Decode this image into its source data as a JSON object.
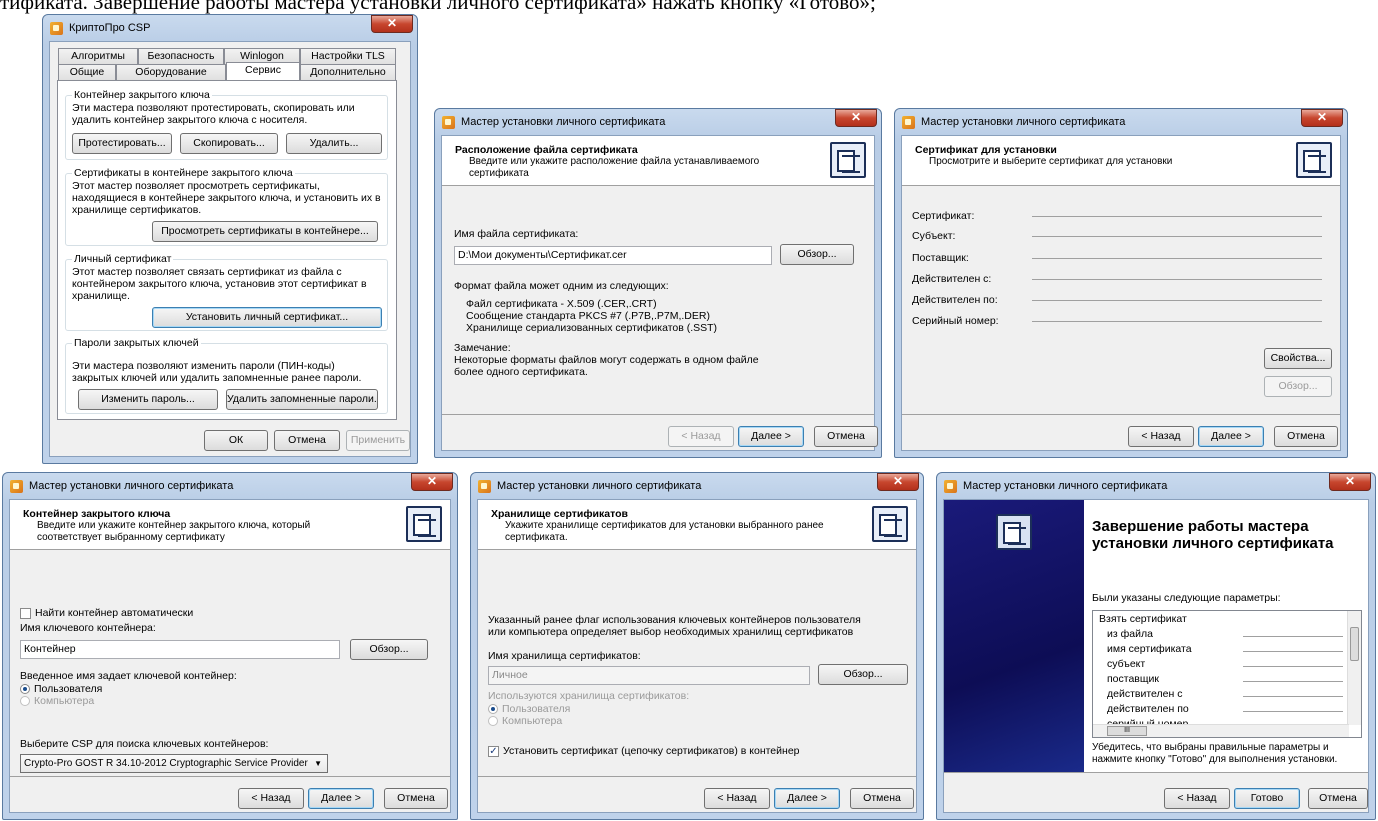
{
  "page_text": "тификата. Завершение работы мастера установки личного сертификата» нажать кнопку «Готово»;",
  "csp": {
    "title": "КриптоПро CSP",
    "tabs_row1": [
      "Алгоритмы",
      "Безопасность",
      "Winlogon",
      "Настройки TLS"
    ],
    "tabs_row2": [
      "Общие",
      "Оборудование",
      "Сервис",
      "Дополнительно"
    ],
    "groups": [
      {
        "label": "Контейнер закрытого ключа",
        "text": "Эти мастера позволяют протестировать, скопировать или удалить контейнер закрытого ключа с носителя."
      },
      {
        "label": "Сертификаты в контейнере закрытого ключа",
        "text": "Этот мастер позволяет просмотреть сертификаты, находящиеся в контейнере закрытого ключа, и установить их в хранилище сертификатов."
      },
      {
        "label": "Личный сертификат",
        "text": "Этот мастер позволяет связать сертификат из файла с контейнером закрытого ключа, установив этот сертификат в хранилище."
      },
      {
        "label": "Пароли закрытых ключей",
        "text": "Эти мастера позволяют изменить пароли (ПИН-коды) закрытых ключей или удалить запомненные ранее пароли."
      }
    ],
    "buttons": {
      "test": "Протестировать...",
      "copy": "Скопировать...",
      "delete": "Удалить...",
      "view": "Просмотреть сертификаты в контейнере...",
      "install": "Установить личный сертификат...",
      "change_pwd": "Изменить пароль...",
      "del_pwd": "Удалить запомненные пароли...",
      "ok": "ОК",
      "cancel": "Отмена",
      "apply": "Применить"
    }
  },
  "wizard_title": "Мастер установки личного сертификата",
  "nav": {
    "back": "< Назад",
    "next": "Далее >",
    "cancel": "Отмена",
    "finish": "Готово",
    "browse": "Обзор...",
    "props": "Свойства..."
  },
  "w1": {
    "h1": "Расположение файла сертификата",
    "h2": "Введите или укажите расположение файла устанавливаемого сертификата",
    "file_label": "Имя файла сертификата:",
    "file_value": "D:\\Мои документы\\Сертификат.cer",
    "format_label": "Формат файла может одним из следующих:",
    "formats": [
      "Файл сертификата - X.509 (.CER,.CRT)",
      "Сообщение стандарта PKCS #7 (.P7B,.P7M,.DER)",
      "Хранилище сериализованных сертификатов (.SST)"
    ],
    "note_label": "Замечание:",
    "note_text1": "Некоторые форматы файлов могут содержать в одном файле",
    "note_text2": "более одного сертификата."
  },
  "w2": {
    "h1": "Сертификат для установки",
    "h2": "Просмотрите и выберите сертификат для установки",
    "fields": [
      "Сертификат:",
      "Субъект:",
      "Поставщик:",
      "Действителен с:",
      "Действителен по:",
      "Серийный номер:"
    ]
  },
  "w3": {
    "h1": "Контейнер закрытого ключа",
    "h2": "Введите или укажите контейнер закрытого ключа, который соответствует выбранному сертификату",
    "auto": "Найти контейнер автоматически",
    "name_label": "Имя ключевого контейнера:",
    "name_value": "Контейнер",
    "type_label": "Введенное имя задает ключевой контейнер:",
    "user": "Пользователя",
    "computer": "Компьютера",
    "csp_label": "Выберите CSP для поиска ключевых контейнеров:",
    "csp_value": "Crypto-Pro GOST R 34.10-2012 Cryptographic Service Provider"
  },
  "w4": {
    "h1": "Хранилище сертификатов",
    "h2": "Укажите хранилище сертификатов для установки выбранного ранее сертификата.",
    "info": "Указанный ранее флаг использования ключевых контейнеров пользователя или компьютера определяет выбор необходимых хранилищ сертификатов",
    "store_label": "Имя хранилища сертификатов:",
    "store_value": "Личное",
    "used_label": "Используются хранилища сертификатов:",
    "user": "Пользователя",
    "computer": "Компьютера",
    "install_chain": "Установить сертификат (цепочку сертификатов) в контейнер"
  },
  "w5": {
    "title": "Завершение работы мастера установки личного сертификата",
    "params_label": "Были указаны следующие параметры:",
    "rows": [
      "Взять сертификат",
      "из файла",
      "имя сертификата",
      "субъект",
      "поставщик",
      "действителен с",
      "действителен по",
      "серийный номер"
    ],
    "hscroll": "III",
    "confirm": "Убедитесь, что выбраны правильные параметры и нажмите кнопку \"Готово\" для выполнения установки."
  }
}
